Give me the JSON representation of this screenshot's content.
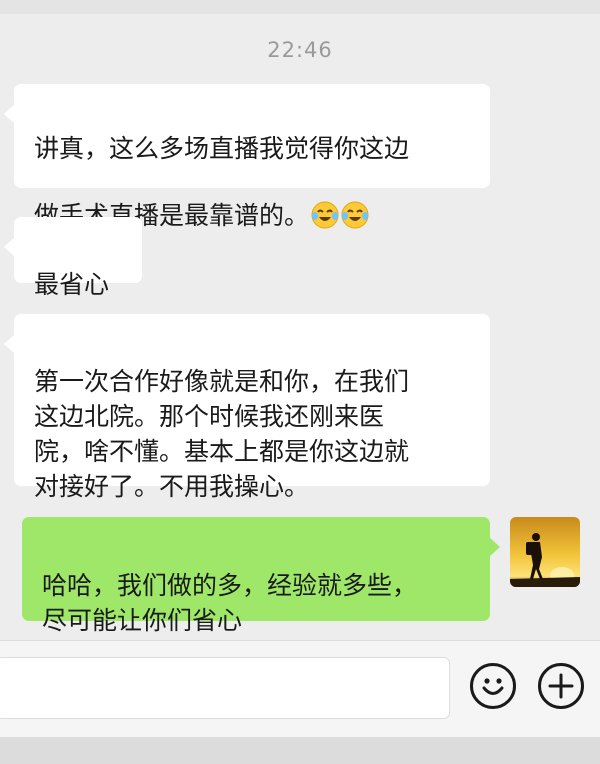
{
  "chat": {
    "timestamp": "22:46",
    "messages": [
      {
        "side": "incoming",
        "text": "讲真，这么多场直播我觉得你这边\n做手术直播是最靠谱的。",
        "emojis": [
          "laughing-crying-emoji",
          "laughing-crying-emoji"
        ]
      },
      {
        "side": "incoming",
        "text": "最省心"
      },
      {
        "side": "incoming",
        "text": "第一次合作好像就是和你，在我们\n这边北院。那个时候我还刚来医\n院，啥不懂。基本上都是你这边就\n对接好了。不用我操心。"
      },
      {
        "side": "outgoing",
        "text": "哈哈，我们做的多，经验就多些，\n尽可能让你们省心"
      }
    ]
  },
  "colors": {
    "chat_background": "#ededed",
    "incoming_bubble": "#ffffff",
    "outgoing_bubble": "#9fe768",
    "timestamp_text": "#9a9a9a",
    "input_bar": "#f5f5f5"
  },
  "icons": {
    "emoji_button": "smiley-face-icon",
    "more_button": "plus-circle-icon"
  }
}
